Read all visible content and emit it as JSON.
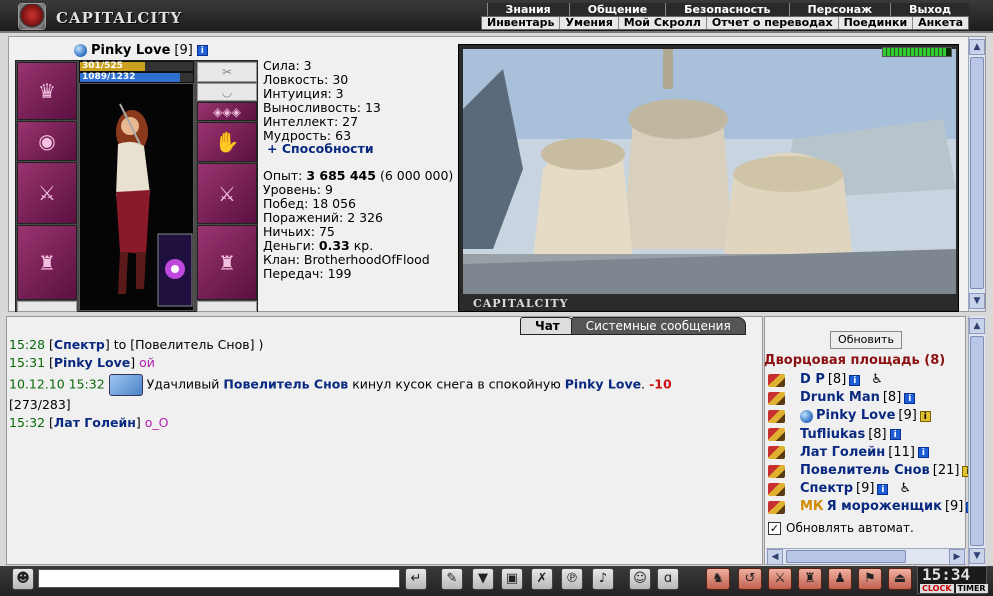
{
  "app": {
    "logo_text": "CAPITALCITY"
  },
  "nav": {
    "main": [
      "Знания",
      "Общение",
      "Безопасность",
      "Персонаж",
      "Выход"
    ],
    "sub": [
      "Инвентарь",
      "Умения",
      "Мой Скролл",
      "Отчет о переводах",
      "Поединки",
      "Анкета"
    ]
  },
  "character": {
    "name": "Pinky Love",
    "level": "[9]",
    "hp_text": "301/525",
    "hp_fraction": 0.573,
    "mp_text": "1089/1232",
    "mp_fraction": 0.884
  },
  "stats": {
    "strength": "Сила: 3",
    "agility": "Ловкость: 30",
    "intuition": "Интуиция: 3",
    "endurance": "Выносливость: 13",
    "intellect": "Интеллект: 27",
    "wisdom": "Мудрость: 63",
    "abilities_link": "+ Способности",
    "exp_label": "Опыт:",
    "exp_value": "3 685 445",
    "exp_next": "(6 000 000)",
    "level_line": "Уровень: 9",
    "wins": "Побед: 18 056",
    "losses": "Поражений: 2 326",
    "draws": "Ничьих: 75",
    "money_label": "Деньги:",
    "money_value": "0.33",
    "money_unit": "кр.",
    "clan": "Клан: BrotherhoodOfFlood",
    "transfers": "Передач: 199"
  },
  "scene": {
    "label": "CAPITALCITY"
  },
  "chat": {
    "tabs": [
      "Чат",
      "Системные сообщения"
    ],
    "line1": {
      "time": "15:28",
      "nick": "Спектр",
      "mid": "to",
      "target": "[Повелитель Снов]",
      "tail": ")"
    },
    "line2": {
      "time": "15:31",
      "nick": "Pinky Love",
      "text": "ой"
    },
    "line3": {
      "time": "10.12.10 15:32",
      "pre": "Удачливый",
      "actor": "Повелитель Снов",
      "mid": "кинул кусок снега в спокойную",
      "victim": "Pinky Love",
      "dmg": "-10",
      "hp": "[273/283]"
    },
    "line4": {
      "time": "15:32",
      "nick": "Лат Голейн",
      "text": "o_O"
    }
  },
  "room": {
    "refresh_label": "Обновить",
    "title": "Дворцовая площадь (8)",
    "users": [
      {
        "name": "D P",
        "level": "[8]"
      },
      {
        "name": "Drunk Man",
        "level": "[8]"
      },
      {
        "name": "Pinky Love",
        "level": "[9]"
      },
      {
        "name": "Tufliukas",
        "level": "[8]"
      },
      {
        "name": "Лат Голейн",
        "level": "[11]"
      },
      {
        "name": "Повелитель Снов",
        "level": "[21]"
      },
      {
        "name": "Спектр",
        "level": "[9]"
      },
      {
        "name": "Я мороженщик",
        "level": "[9]",
        "clan_tag": "МК"
      }
    ],
    "auto_refresh_label": "Обновлять автомат."
  },
  "clock": {
    "time": "15:34",
    "clock_label": "CLOCK",
    "timer_label": "TIMER"
  }
}
